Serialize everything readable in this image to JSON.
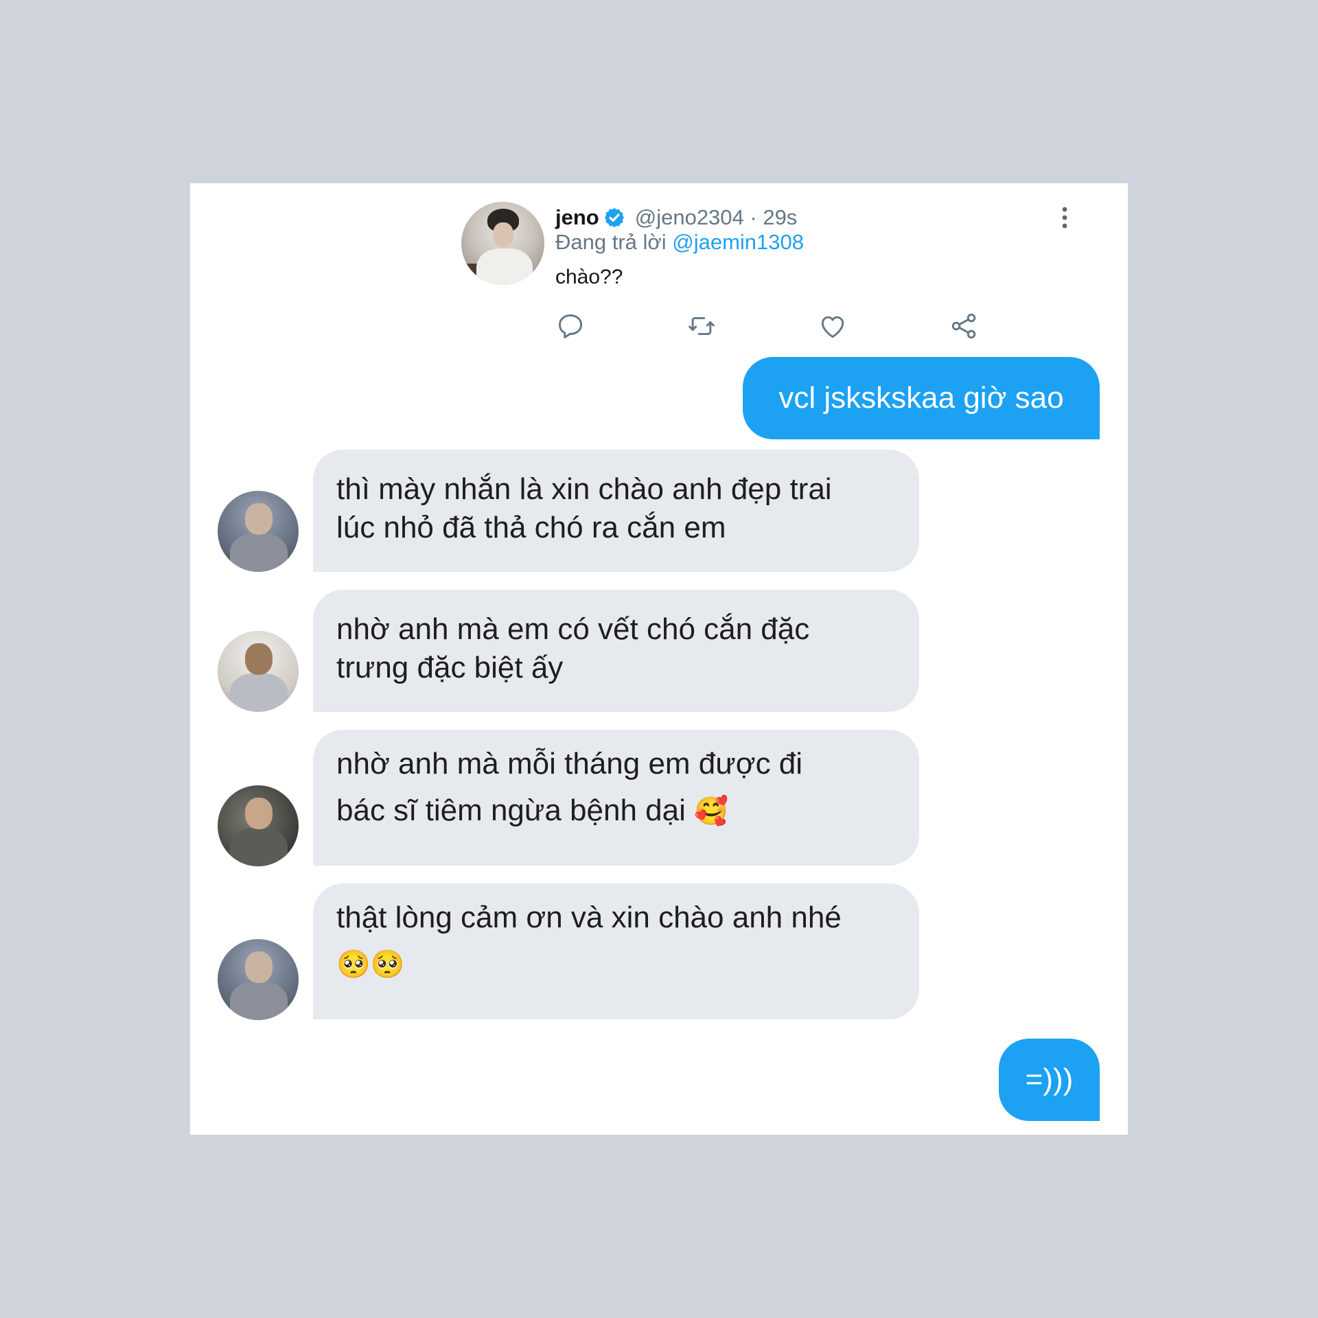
{
  "tweet": {
    "display_name": "jeno",
    "handle_time": "@jeno2304 · 29s",
    "reply_prefix": "Đang trả lời",
    "reply_mention": "@jaemin1308",
    "text": "chào??"
  },
  "messages": {
    "out_1": "vcl jskskskaa giờ sao",
    "in_1": [
      "thì mày nhắn là xin chào anh đẹp trai",
      "lúc nhỏ đã thả chó ra cắn em"
    ],
    "in_2": [
      "nhờ anh mà em có vết chó cắn đặc",
      "trưng đặc biệt ấy"
    ],
    "in_3": [
      "nhờ anh mà mỗi tháng em được đi",
      "bác sĩ tiêm ngừa bệnh dại"
    ],
    "in_3_emoji": "🥰",
    "in_4": [
      "thật lòng cảm ơn và xin chào anh nhé"
    ],
    "in_4_emoji": "🥺🥺",
    "out_2": "=)))"
  },
  "icons": {
    "verified": "verified-badge-icon",
    "more": "more-vertical-icon",
    "reply": "reply-icon",
    "retweet": "retweet-icon",
    "like": "heart-icon",
    "share": "share-icon"
  },
  "colors": {
    "accent": "#1da1f2",
    "incoming_bubble": "#e6e9ee",
    "background": "#cfd3dc"
  }
}
